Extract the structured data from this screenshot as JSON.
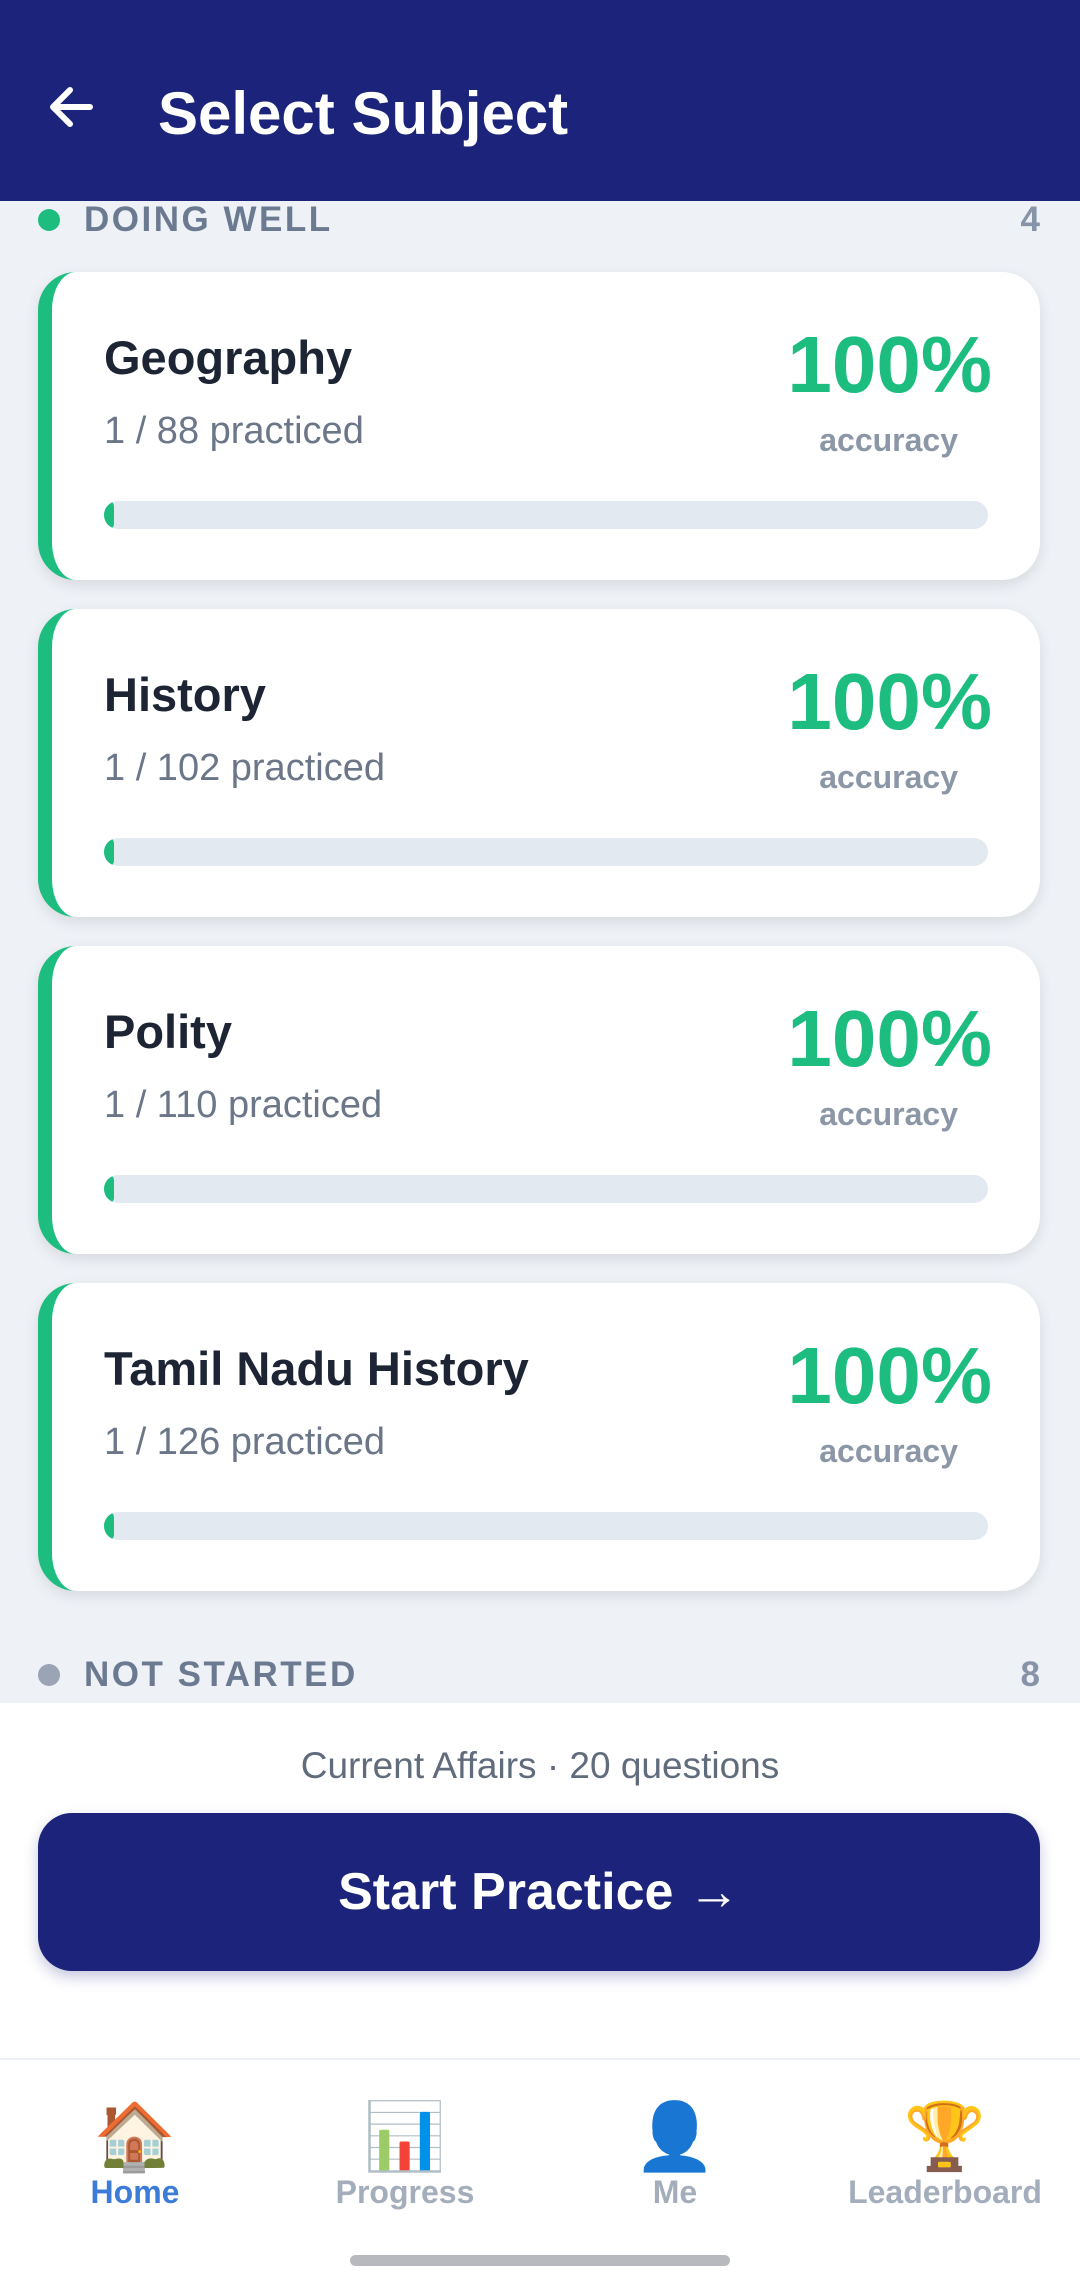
{
  "header": {
    "title": "Select Subject"
  },
  "sections": {
    "doing_well": {
      "label": "DOING WELL",
      "count": "4",
      "dot_color": "#1dbd80"
    },
    "not_started": {
      "label": "NOT STARTED",
      "count": "8",
      "dot_color": "#9aa4b5"
    }
  },
  "subjects": [
    {
      "name": "Geography",
      "practiced": "1 / 88 practiced",
      "accuracy": "100%",
      "accuracy_label": "accuracy",
      "progress": 0.011
    },
    {
      "name": "History",
      "practiced": "1 / 102 practiced",
      "accuracy": "100%",
      "accuracy_label": "accuracy",
      "progress": 0.01
    },
    {
      "name": "Polity",
      "practiced": "1 / 110 practiced",
      "accuracy": "100%",
      "accuracy_label": "accuracy",
      "progress": 0.009
    },
    {
      "name": "Tamil Nadu History",
      "practiced": "1 / 126 practiced",
      "accuracy": "100%",
      "accuracy_label": "accuracy",
      "progress": 0.008
    }
  ],
  "footer": {
    "info": "Current Affairs · 20 questions",
    "start_label": "Start Practice →"
  },
  "nav": {
    "items": [
      {
        "label": "Home",
        "icon": "🏠",
        "icon_name": "home-icon",
        "active": true
      },
      {
        "label": "Progress",
        "icon": "📊",
        "icon_name": "bar-chart-icon",
        "active": false
      },
      {
        "label": "Me",
        "icon": "👤",
        "icon_name": "user-icon",
        "active": false
      },
      {
        "label": "Leaderboard",
        "icon": "🏆",
        "icon_name": "trophy-icon",
        "active": false
      }
    ]
  },
  "colors": {
    "primary": "#1b237a",
    "success": "#1dbd80",
    "nav_active": "#3d7bd9"
  }
}
